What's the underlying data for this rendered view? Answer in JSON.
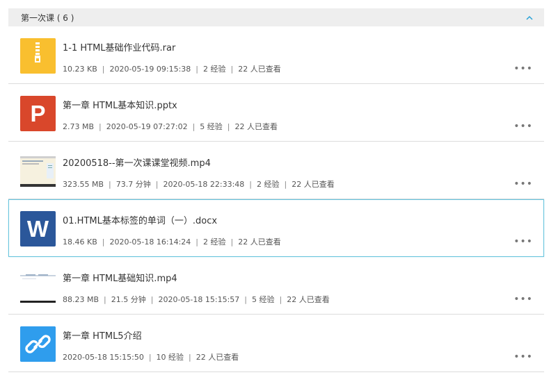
{
  "section": {
    "title": "第一次课 ( 6 )",
    "collapse_icon": "chevron-up-icon",
    "accent": "#27a2d7"
  },
  "files": [
    {
      "title": "1-1 HTML基础作业代码.rar",
      "icon": "zip-file-icon",
      "color": "#f9bf2f",
      "meta": [
        "10.23 KB",
        "2020-05-19 09:15:38",
        "2 经验",
        "22 人已查看"
      ]
    },
    {
      "title": "第一章 HTML基本知识.pptx",
      "icon": "powerpoint-file-icon",
      "icon_letter": "P",
      "color": "#d9472b",
      "meta": [
        "2.73 MB",
        "2020-05-19 07:27:02",
        "5 经验",
        "22 人已查看"
      ]
    },
    {
      "title": "20200518--第一次课课堂视频.mp4",
      "icon": "video-thumbnail",
      "meta": [
        "323.55 MB",
        "73.7 分钟",
        "2020-05-18 22:33:48",
        "2 经验",
        "22 人已查看"
      ]
    },
    {
      "title": "01.HTML基本标签的单词（一）.docx",
      "icon": "word-file-icon",
      "icon_letter": "W",
      "color": "#2b579a",
      "meta": [
        "18.46 KB",
        "2020-05-18 16:14:24",
        "2 经验",
        "22 人已查看"
      ]
    },
    {
      "title": "第一章 HTML基础知识.mp4",
      "icon": "video-thumbnail",
      "meta": [
        "88.23 MB",
        "21.5 分钟",
        "2020-05-18 15:15:57",
        "5 经验",
        "22 人已查看"
      ]
    },
    {
      "title": "第一章 HTML5介绍",
      "icon": "link-icon",
      "color": "#2f9ded",
      "meta": [
        "2020-05-18 15:15:50",
        "10 经验",
        "22 人已查看"
      ]
    }
  ],
  "more_label": "•••",
  "selection_color": "#67c4dd"
}
